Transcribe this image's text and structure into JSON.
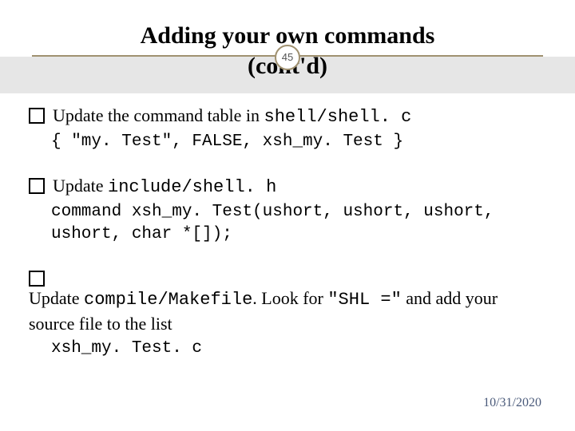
{
  "page_number": "45",
  "title": {
    "line1": "Adding your own commands",
    "line2": "(cont'd)"
  },
  "items": [
    {
      "lead_serif_a": "Update the command table in ",
      "lead_mono_a": "shell/shell. c",
      "code": "{ \"my. Test\", FALSE, xsh_my. Test }"
    },
    {
      "lead_serif_a": "Update ",
      "lead_mono_a": "include/shell. h",
      "code": "command xsh_my. Test(ushort, ushort, ushort, ushort, char *[]);"
    },
    {
      "lead_serif_a": "Update ",
      "lead_mono_a": "compile/Makefile",
      "lead_serif_b": ". Look for ",
      "lead_mono_b": "\"SHL =\"",
      "lead_serif_c": " and add your source file to the list",
      "code": "xsh_my. Test. c"
    }
  ],
  "footer_date": "10/31/2020"
}
